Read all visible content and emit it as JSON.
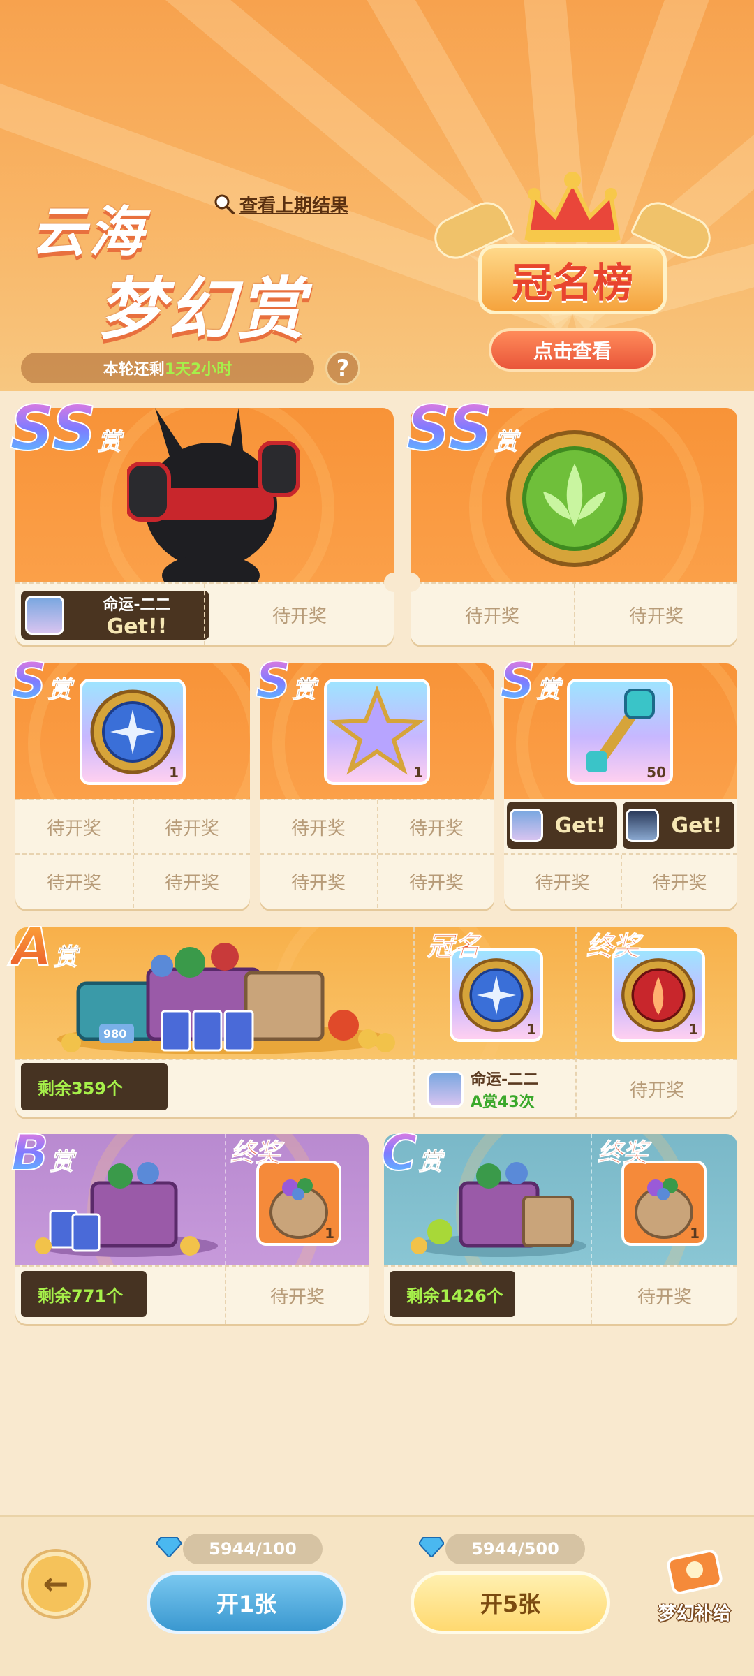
{
  "header": {
    "logo_line1": "云海",
    "logo_line2": "梦幻赏",
    "prev_results_link": "查看上期结果",
    "timer_prefix": "本轮还剩",
    "timer_value": "1天2小时",
    "help_icon": "?",
    "ranking_title": "冠名榜",
    "ranking_button": "点击查看"
  },
  "ss_prizes": {
    "tier": "SS",
    "tier_suffix": "赏",
    "card1": {
      "winner_name": "命运-二二",
      "winner_tag": "Get!!",
      "slot": "待开奖"
    },
    "card2": {
      "slot1": "待开奖",
      "slot2": "待开奖"
    }
  },
  "s_prizes": {
    "tier": "S",
    "tier_suffix": "赏",
    "items": [
      {
        "count": "1",
        "slots": [
          "待开奖",
          "待开奖",
          "待开奖",
          "待开奖"
        ]
      },
      {
        "count": "1",
        "slots": [
          "待开奖",
          "待开奖",
          "待开奖",
          "待开奖"
        ]
      },
      {
        "count": "50",
        "winners": [
          "Get!",
          "Get!"
        ],
        "slots": [
          "待开奖",
          "待开奖"
        ]
      }
    ]
  },
  "a_prize": {
    "tier": "A",
    "tier_suffix": "赏",
    "pile_value": "980",
    "remaining": "剩余359个",
    "title_label": "冠名",
    "title_item_count": "1",
    "title_holder": "命运-二二",
    "title_holder_stat": "A赏43次",
    "final_label": "终奖",
    "final_item_count": "1",
    "final_slot": "待开奖"
  },
  "b_prize": {
    "tier": "B",
    "tier_suffix": "赏",
    "remaining": "剩余771个",
    "final_label": "终奖",
    "final_item_count": "1",
    "final_slot": "待开奖"
  },
  "c_prize": {
    "tier": "C",
    "tier_suffix": "赏",
    "remaining": "剩余1426个",
    "final_label": "终奖",
    "final_item_count": "1",
    "final_slot": "待开奖"
  },
  "footer": {
    "gem1_count": "5944/100",
    "gem2_count": "5944/500",
    "open1_label": "开1张",
    "open5_label": "开5张",
    "supply_label": "梦幻补给",
    "back_icon": "←"
  },
  "colors": {
    "accent_orange": "#f89338",
    "open1_blue": "#4aa7d8",
    "open5_yellow": "#ffd970",
    "remain_green": "#a6f04a"
  }
}
